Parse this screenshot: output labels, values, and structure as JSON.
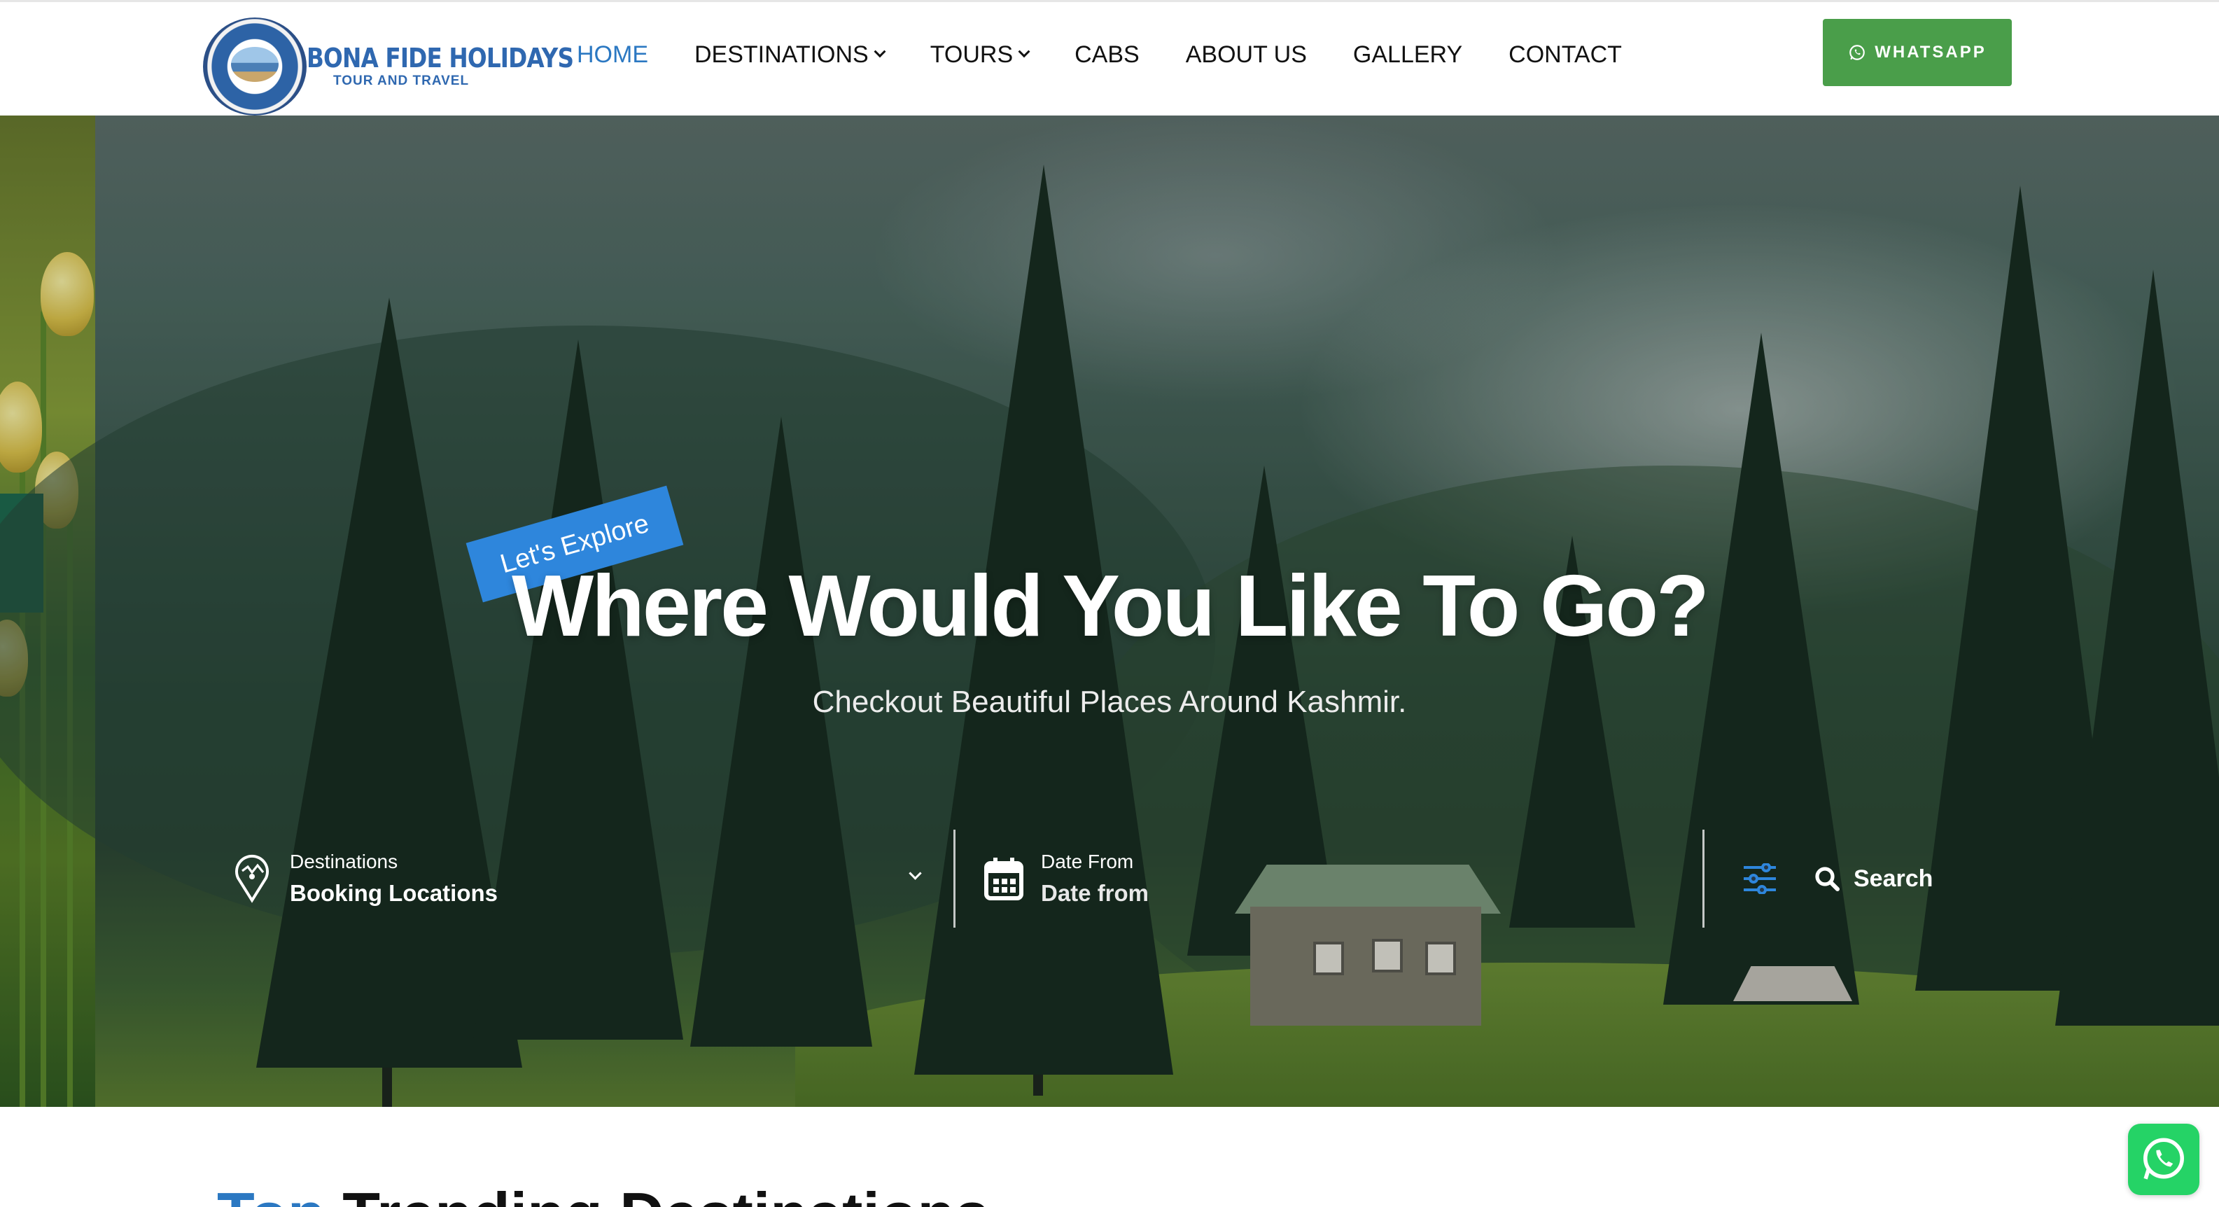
{
  "brand": {
    "name": "BONA FIDE HOLIDAYS",
    "tagline": "TOUR AND TRAVEL"
  },
  "nav": {
    "items": [
      {
        "label": "HOME",
        "active": true,
        "dropdown": false
      },
      {
        "label": "DESTINATIONS",
        "active": false,
        "dropdown": true
      },
      {
        "label": "TOURS",
        "active": false,
        "dropdown": true
      },
      {
        "label": "CABS",
        "active": false,
        "dropdown": false
      },
      {
        "label": "ABOUT US",
        "active": false,
        "dropdown": false
      },
      {
        "label": "GALLERY",
        "active": false,
        "dropdown": false
      },
      {
        "label": "CONTACT",
        "active": false,
        "dropdown": false
      }
    ],
    "cta_label": "WHATSAPP"
  },
  "hero": {
    "tag": "Let's Explore",
    "title": "Where Would You Like To Go?",
    "subtitle": "Checkout Beautiful Places Around Kashmir."
  },
  "search": {
    "destination": {
      "label": "Destinations",
      "value": "Booking Locations"
    },
    "date": {
      "label": "Date From",
      "value": "Date from"
    },
    "button_label": "Search"
  },
  "section": {
    "heading_highlight": "Top",
    "heading_rest": "Trending Destinations"
  },
  "colors": {
    "accent": "#2b78c2",
    "tag_bg": "#2e86dc",
    "whatsapp_btn": "#4a9e4a",
    "whatsapp_float": "#25d366"
  },
  "icons": [
    "whatsapp-icon",
    "chevron-down-icon",
    "map-pin-icon",
    "calendar-icon",
    "sliders-icon",
    "search-icon"
  ]
}
